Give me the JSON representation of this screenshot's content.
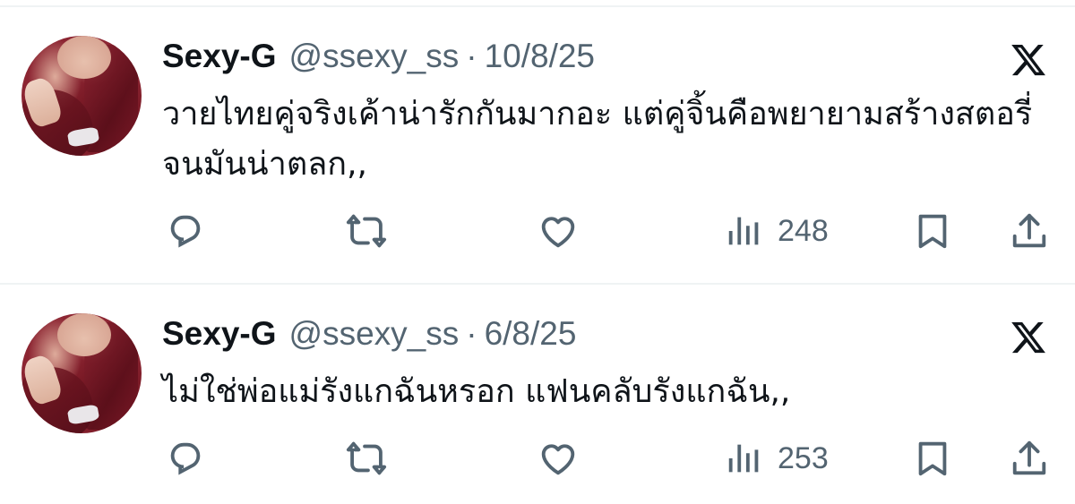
{
  "colors": {
    "text_primary": "#0f1419",
    "text_secondary": "#536471",
    "divider": "#eff3f4",
    "background": "#ffffff"
  },
  "tweets": [
    {
      "author_name": "Sexy-G",
      "handle": "@ssexy_ss",
      "separator": "·",
      "date": "10/8/25",
      "text": "วายไทยคู่จริงเค้าน่ารักกันมากอะ แต่คู่จิ้นคือพยายามสร้างสตอรี่จนมันน่าตลก,,",
      "views": "248",
      "icons": [
        "reply-icon",
        "retweet-icon",
        "like-icon",
        "views-icon",
        "bookmark-icon",
        "share-icon",
        "x-logo-icon"
      ]
    },
    {
      "author_name": "Sexy-G",
      "handle": "@ssexy_ss",
      "separator": "·",
      "date": "6/8/25",
      "text": "ไม่ใช่พ่อแม่รังแกฉันหรอก แฟนคลับรังแกฉัน,,",
      "views": "253",
      "icons": [
        "reply-icon",
        "retweet-icon",
        "like-icon",
        "views-icon",
        "bookmark-icon",
        "share-icon",
        "x-logo-icon"
      ]
    }
  ]
}
